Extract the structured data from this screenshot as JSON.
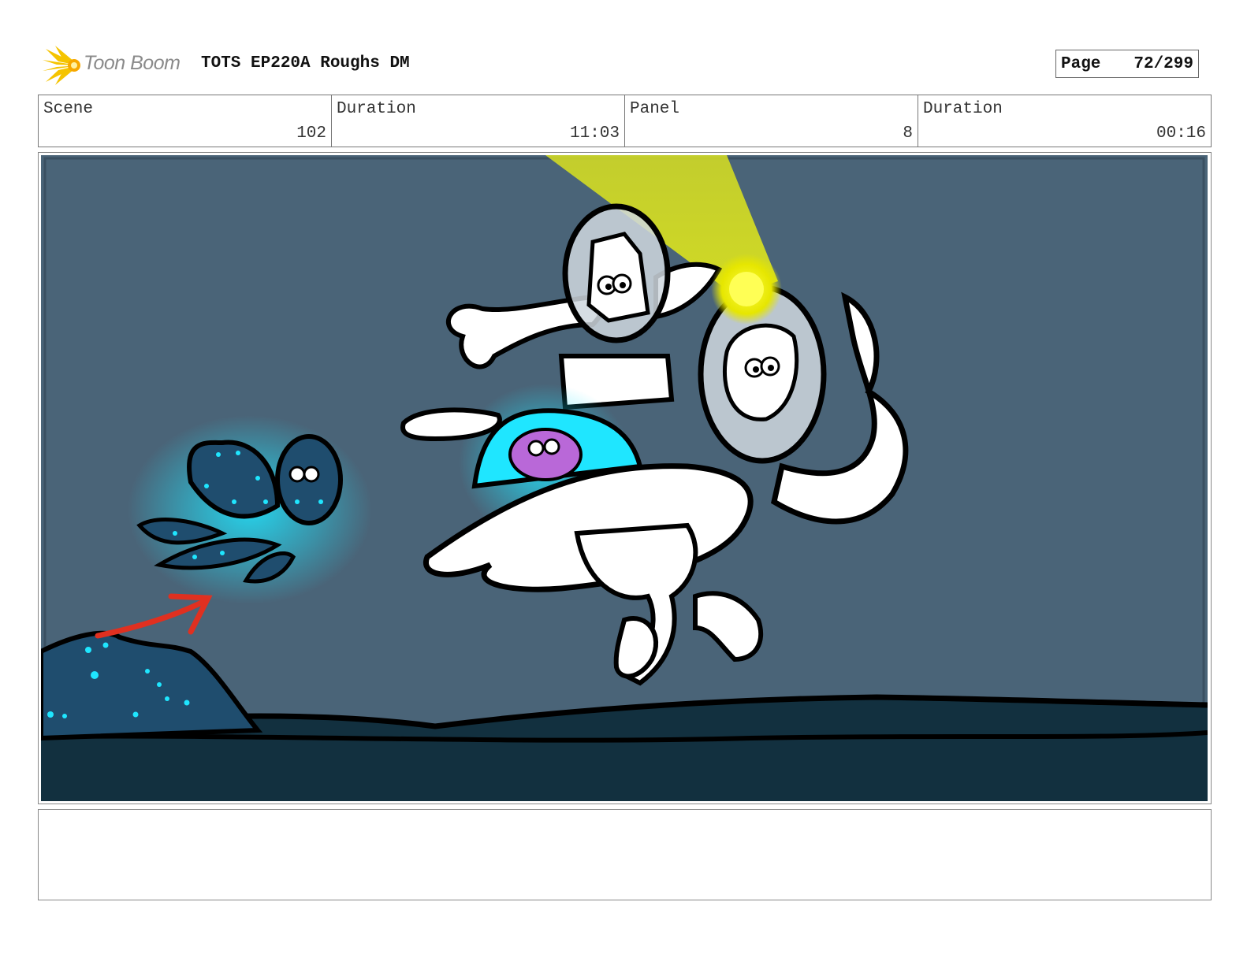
{
  "header": {
    "logo_text": "Toon Boom",
    "logo_icon": "toon-boom-starburst-icon",
    "title": "TOTS EP220A Roughs DM",
    "page_label": "Page",
    "page_value": "72/299"
  },
  "info": {
    "scene_label": "Scene",
    "scene_value": "102",
    "duration_label": "Duration",
    "duration_value": "11:03",
    "panel_label": "Panel",
    "panel_value": "8",
    "panel_duration_label": "Duration",
    "panel_duration_value": "00:16"
  },
  "colors": {
    "water": "#4a6478",
    "seabed": "#12303f",
    "glow_cyan": "#1fe6ff",
    "spotlight": "#d8e020",
    "arrow": "#e03020",
    "logo_yellow": "#f5c400"
  },
  "notes": ""
}
